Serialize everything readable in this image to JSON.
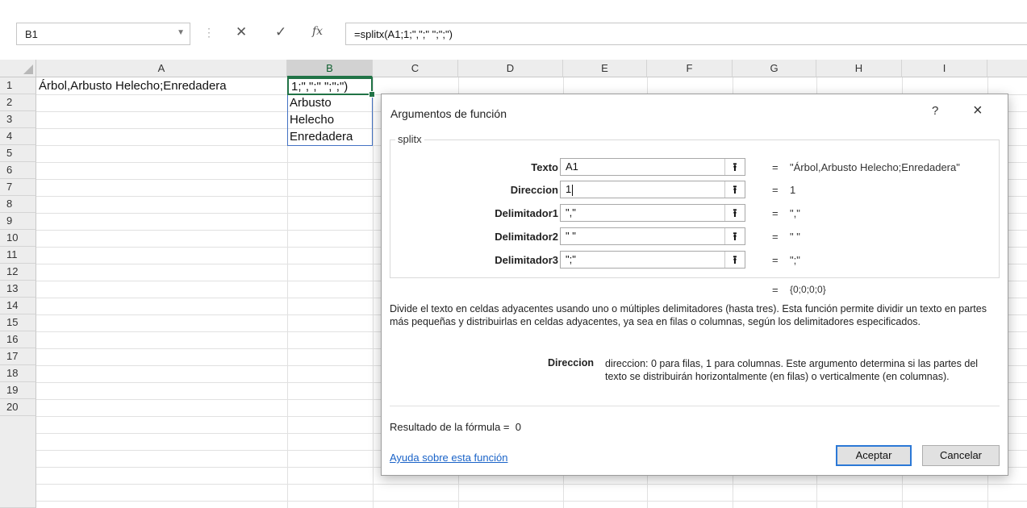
{
  "formula_bar": {
    "name_box": "B1",
    "cancel_glyph": "✕",
    "enter_glyph": "✓",
    "fx_label": "fx",
    "formula": "=splitx(A1;1;\",\";\" \";\";\")"
  },
  "grid": {
    "columns": [
      "A",
      "B",
      "C",
      "D",
      "E",
      "F",
      "G",
      "H",
      "I"
    ],
    "selected_column": "B",
    "rows": [
      "1",
      "2",
      "3",
      "4",
      "5",
      "6",
      "7",
      "8",
      "9",
      "10",
      "11",
      "12",
      "13",
      "14",
      "15",
      "16",
      "17",
      "18",
      "19",
      "20"
    ],
    "cells": {
      "A1": "Árbol,Arbusto Helecho;Enredadera",
      "B1": "1;\",\";\" \";\";\")",
      "B2": "Arbusto",
      "B3": "Helecho",
      "B4": "Enredadera"
    }
  },
  "dialog": {
    "title": "Argumentos de función",
    "help_glyph": "?",
    "close_glyph": "×",
    "function_name": "splitx",
    "arguments": [
      {
        "label": "Texto",
        "input": "A1",
        "value": "\"Árbol,Arbusto Helecho;Enredadera\""
      },
      {
        "label": "Direccion",
        "input": "1",
        "value": "1"
      },
      {
        "label": "Delimitador1",
        "input": "\",\"",
        "value": "\",\""
      },
      {
        "label": "Delimitador2",
        "input": "\" \"",
        "value": "\" \""
      },
      {
        "label": "Delimitador3",
        "input": "\";\"",
        "value": "\";\""
      }
    ],
    "equals": "=",
    "collapse_glyph": "⭱",
    "result_preview": "{0;0;0;0}",
    "description": "Divide el texto en celdas adyacentes usando uno o múltiples delimitadores (hasta tres). Esta función permite dividir un texto en partes más pequeñas y distribuirlas en celdas adyacentes, ya sea en filas o columnas, según los delimitadores especificados.",
    "arg_help_name": "Direccion",
    "arg_help_text": "direccion: 0 para filas, 1 para columnas. Este argumento determina si las partes del texto se distribuirán horizontalmente (en filas) o verticalmente (en columnas).",
    "result_label": "Resultado de la fórmula =",
    "result_value": "0",
    "help_link": "Ayuda sobre esta función",
    "ok_label": "Aceptar",
    "cancel_label": "Cancelar"
  },
  "colors": {
    "excel_green": "#217346",
    "link_blue": "#1a63c8",
    "focus_blue": "#2b78d6"
  }
}
